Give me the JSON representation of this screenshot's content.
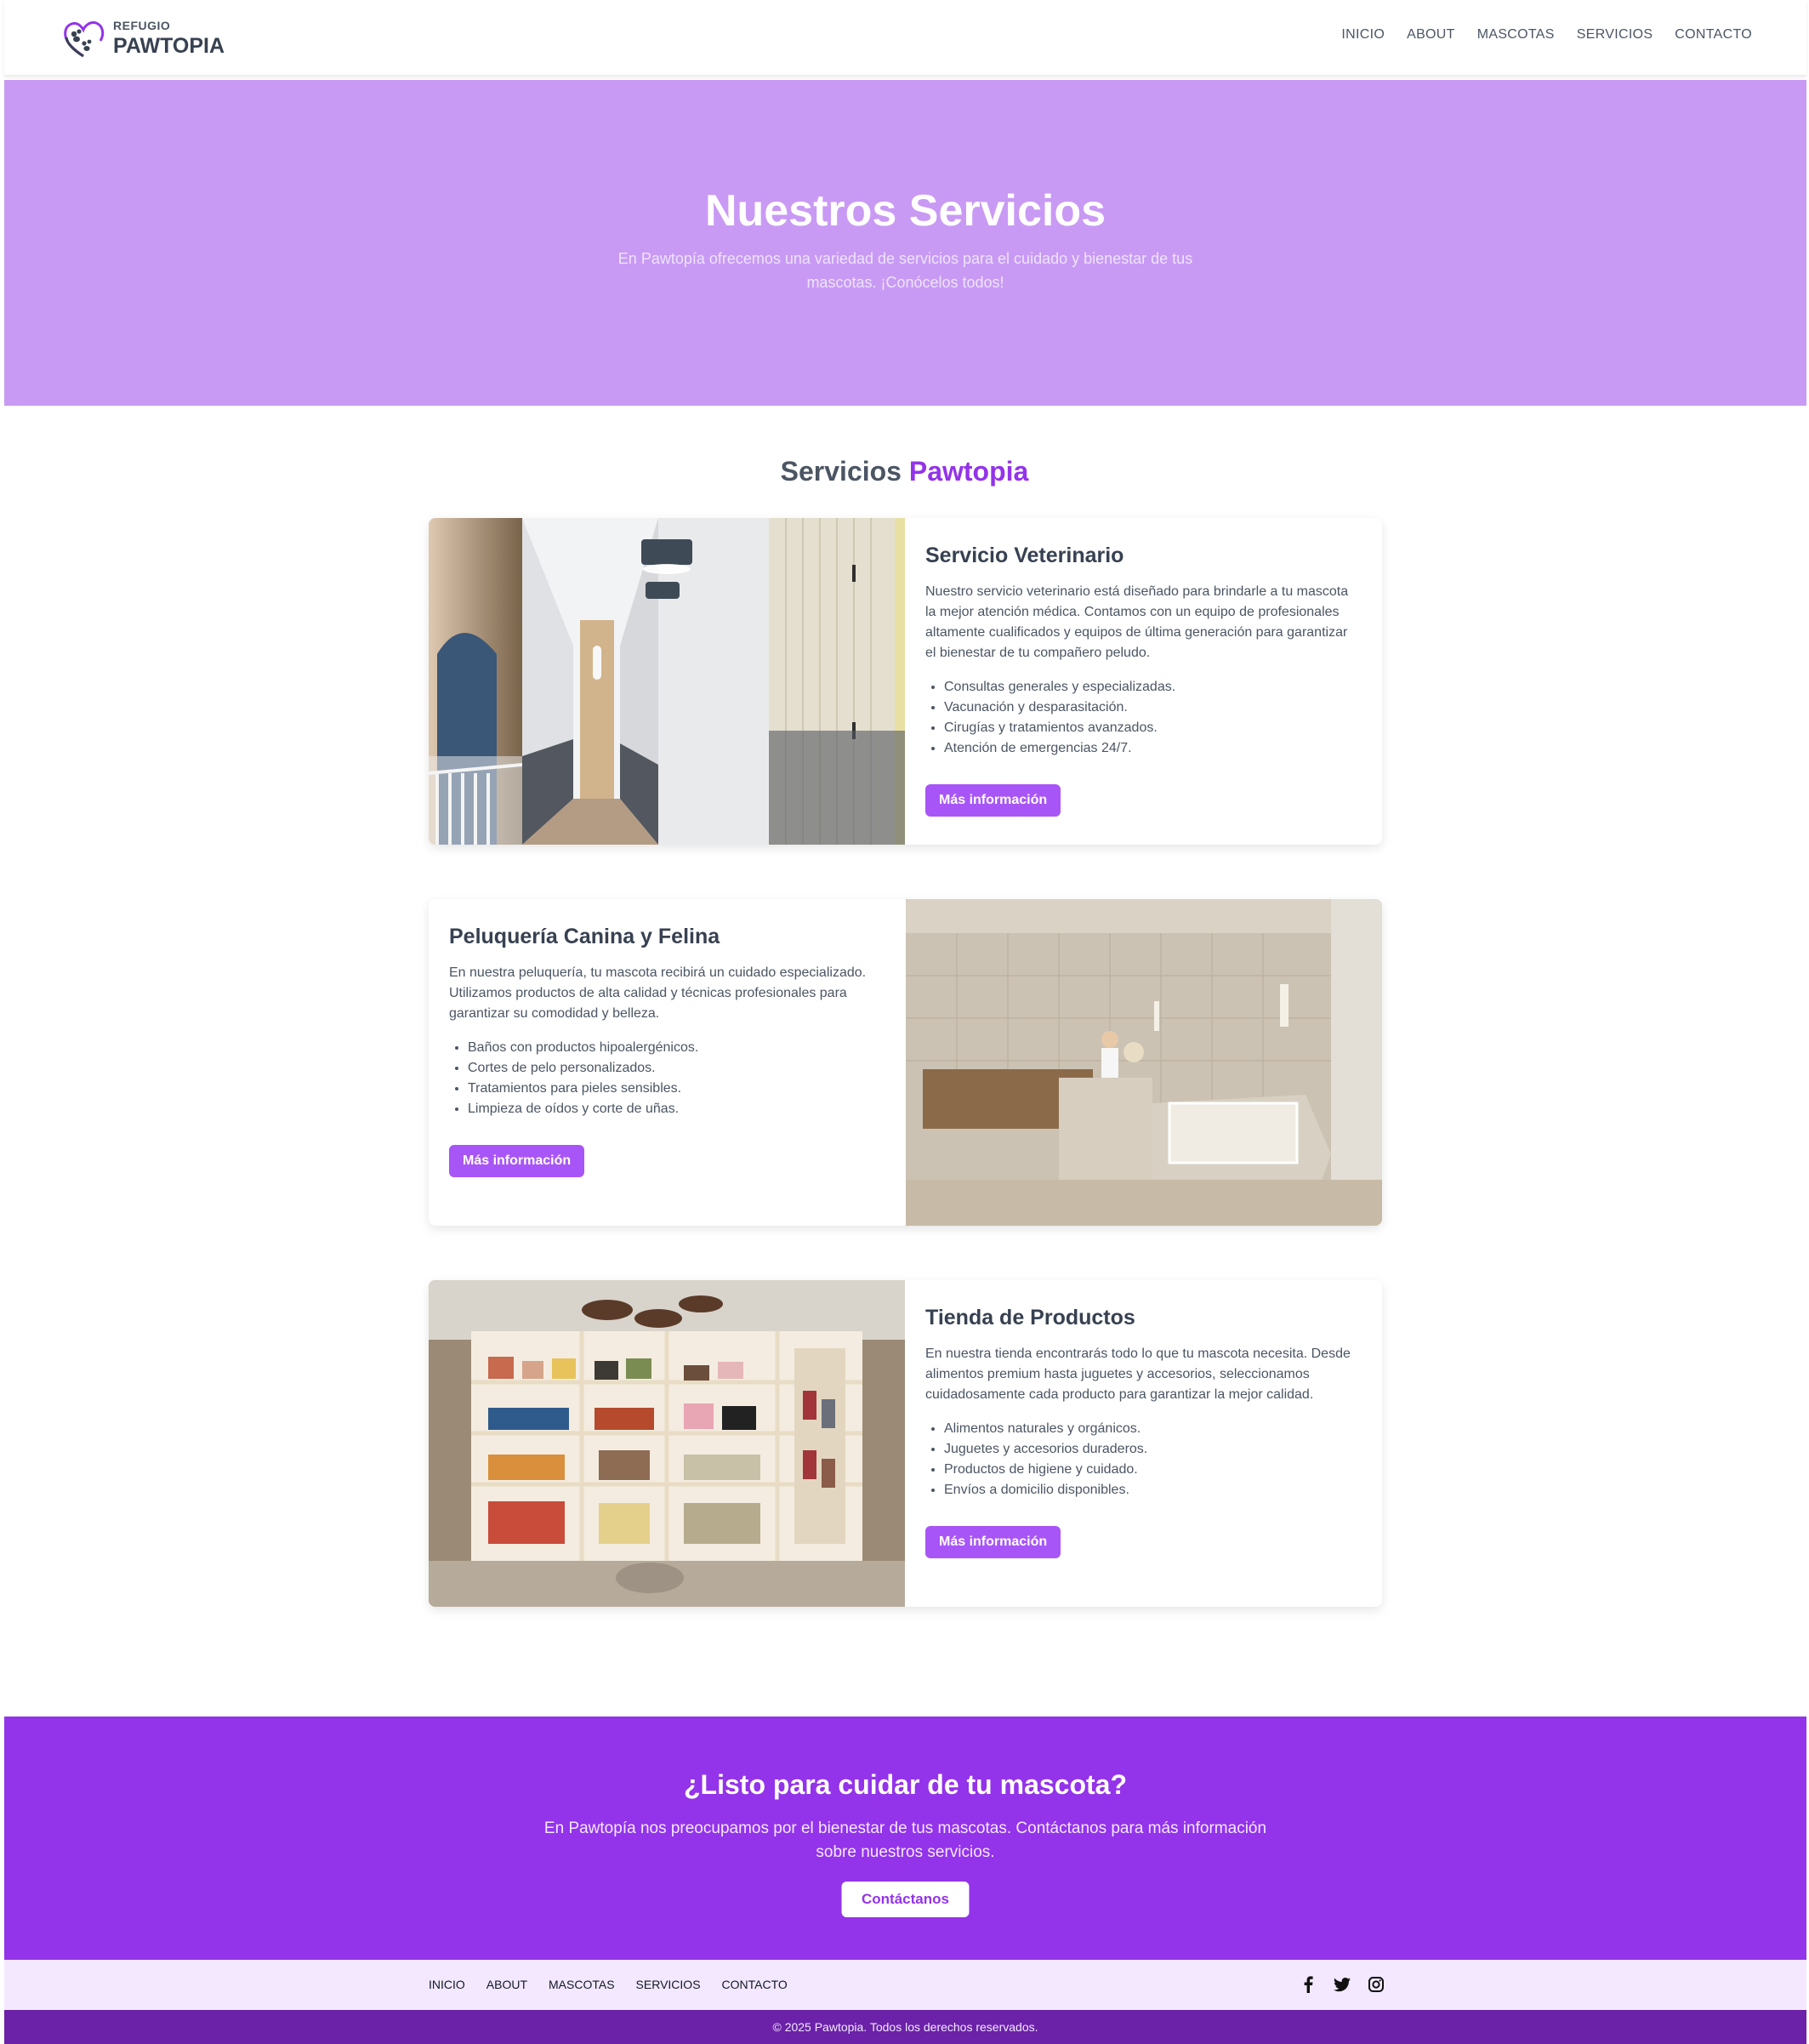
{
  "header": {
    "logo_small": "REFUGIO",
    "logo_big": "PAWTOPIA",
    "nav": [
      "INICIO",
      "ABOUT",
      "MASCOTAS",
      "SERVICIOS",
      "CONTACTO"
    ]
  },
  "hero": {
    "title": "Nuestros Servicios",
    "subtitle": "En Pawtopía ofrecemos una variedad de servicios para el cuidado y bienestar de tus mascotas. ¡Conócelos todos!"
  },
  "section": {
    "title_main": "Servicios ",
    "title_accent": "Pawtopia"
  },
  "services": [
    {
      "title": "Servicio Veterinario",
      "description": "Nuestro servicio veterinario está diseñado para brindarle a tu mascota la mejor atención médica. Contamos con un equipo de profesionales altamente cualificados y equipos de última generación para garantizar el bienestar de tu compañero peludo.",
      "items": [
        "Consultas generales y especializadas.",
        "Vacunación y desparasitación.",
        "Cirugías y tratamientos avanzados.",
        "Atención de emergencias 24/7."
      ],
      "button": "Más información"
    },
    {
      "title": "Peluquería Canina y Felina",
      "description": "En nuestra peluquería, tu mascota recibirá un cuidado especializado. Utilizamos productos de alta calidad y técnicas profesionales para garantizar su comodidad y belleza.",
      "items": [
        "Baños con productos hipoalergénicos.",
        "Cortes de pelo personalizados.",
        "Tratamientos para pieles sensibles.",
        "Limpieza de oídos y corte de uñas."
      ],
      "button": "Más información"
    },
    {
      "title": "Tienda de Productos",
      "description": "En nuestra tienda encontrarás todo lo que tu mascota necesita. Desde alimentos premium hasta juguetes y accesorios, seleccionamos cuidadosamente cada producto para garantizar la mejor calidad.",
      "items": [
        "Alimentos naturales y orgánicos.",
        "Juguetes y accesorios duraderos.",
        "Productos de higiene y cuidado.",
        "Envíos a domicilio disponibles."
      ],
      "button": "Más información"
    }
  ],
  "cta": {
    "title": "¿Listo para cuidar de tu mascota?",
    "text": "En Pawtopía nos preocupamos por el bienestar de tus mascotas. Contáctanos para más información sobre nuestros servicios.",
    "button": "Contáctanos"
  },
  "footer": {
    "nav": [
      "INICIO",
      "ABOUT",
      "MASCOTAS",
      "SERVICIOS",
      "CONTACTO"
    ],
    "social": [
      "facebook-icon",
      "twitter-icon",
      "instagram-icon"
    ],
    "copyright": "© 2025 Pawtopia. Todos los derechos reservados."
  },
  "colors": {
    "hero_bg": "#c99af4",
    "accent": "#9333ea",
    "button": "#a855f7",
    "footer_bg": "#f3e8ff",
    "copyright_bg": "#6b21a8"
  }
}
